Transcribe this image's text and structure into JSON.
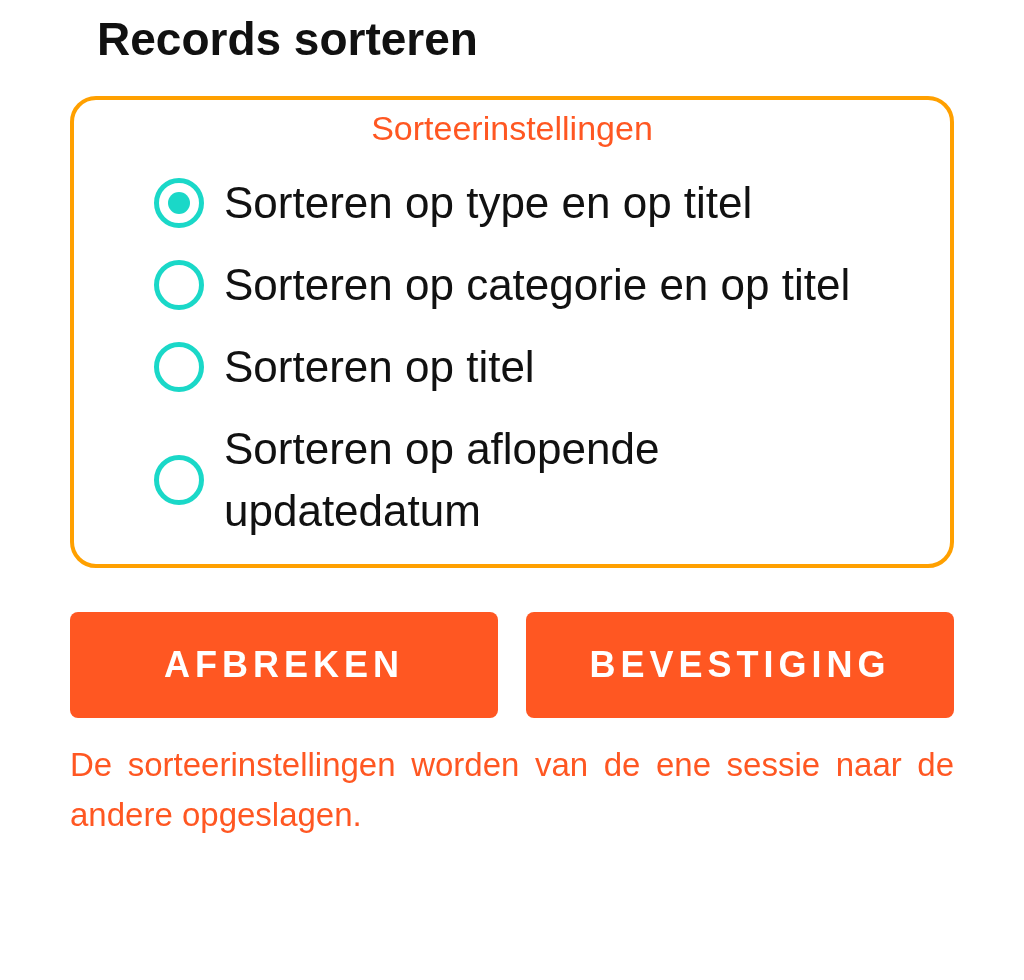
{
  "title": "Records sorteren",
  "group": {
    "legend": "Sorteerinstellingen",
    "options": [
      {
        "label": "Sorteren op type en op titel",
        "selected": true
      },
      {
        "label": "Sorteren op categorie en op titel",
        "selected": false
      },
      {
        "label": "Sorteren op titel",
        "selected": false
      },
      {
        "label": "Sorteren op aflopende updatedatum",
        "selected": false
      }
    ]
  },
  "buttons": [
    "AFBREKEN",
    "BEVESTIGING"
  ],
  "note": "De sorteerinstellingen worden van de ene sessie naar de andere opgeslagen."
}
